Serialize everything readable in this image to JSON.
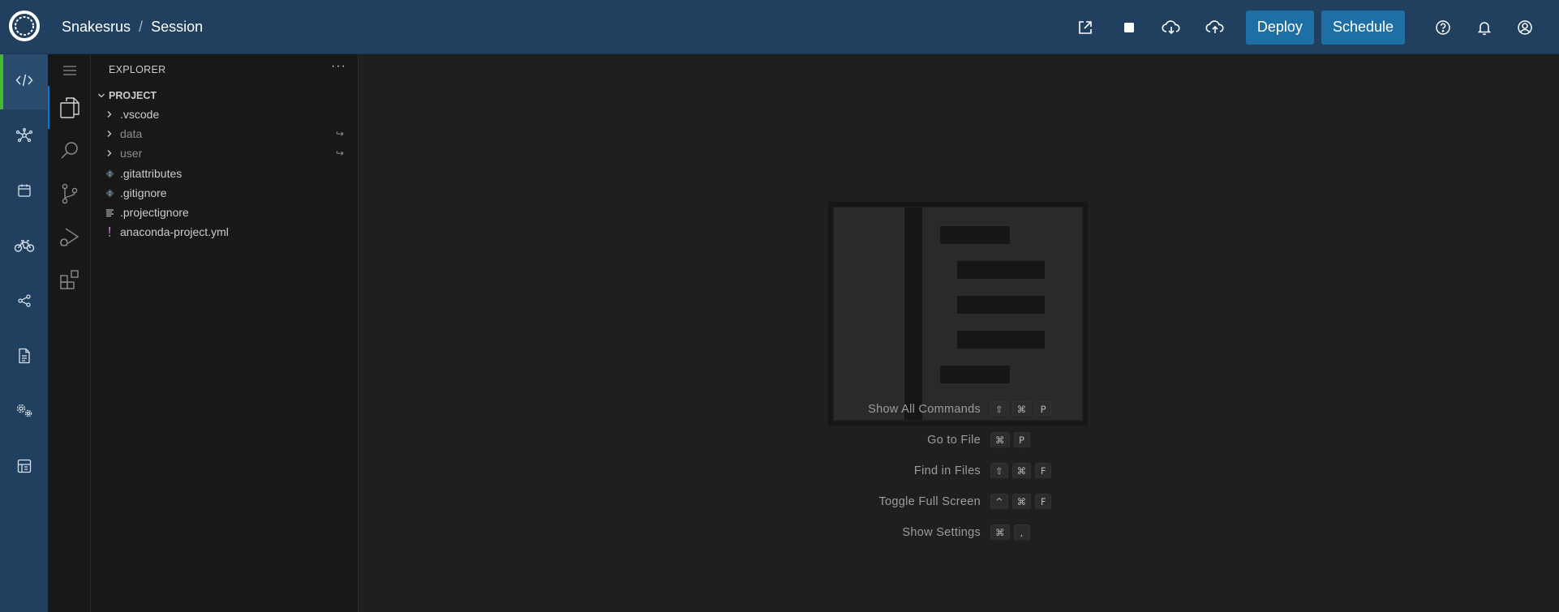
{
  "topbar": {
    "project": "Snakesrus",
    "separator": "/",
    "page": "Session",
    "deploy_label": "Deploy",
    "schedule_label": "Schedule",
    "accent_color": "#1e6fa6",
    "background_color": "#21405f"
  },
  "appnav": {
    "items": [
      {
        "name": "code",
        "icon": "code-icon",
        "active": true
      },
      {
        "name": "network",
        "icon": "network-icon"
      },
      {
        "name": "calendar",
        "icon": "calendar-icon"
      },
      {
        "name": "bicycle",
        "icon": "bicycle-icon"
      },
      {
        "name": "share",
        "icon": "share-icon"
      },
      {
        "name": "document",
        "icon": "document-icon"
      },
      {
        "name": "settings",
        "icon": "gears-icon"
      },
      {
        "name": "storage",
        "icon": "storage-icon"
      }
    ]
  },
  "activity_bar": {
    "items": [
      "menu-icon",
      "files-icon",
      "search-icon",
      "source-control-icon",
      "run-debug-icon",
      "extensions-icon"
    ]
  },
  "explorer": {
    "title": "EXPLORER",
    "more": "···",
    "project_label": "PROJECT",
    "tree": [
      {
        "label": ".vscode",
        "type": "folder",
        "dim": false
      },
      {
        "label": "data",
        "type": "folder",
        "dim": true,
        "decoration": "↪"
      },
      {
        "label": "user",
        "type": "folder",
        "dim": true,
        "decoration": "↪"
      },
      {
        "label": ".gitattributes",
        "type": "git"
      },
      {
        "label": ".gitignore",
        "type": "git"
      },
      {
        "label": ".projectignore",
        "type": "text"
      },
      {
        "label": "anaconda-project.yml",
        "type": "yaml"
      }
    ]
  },
  "editor": {
    "shortcuts": [
      {
        "label": "Show All Commands",
        "keys": [
          "⇧",
          "⌘",
          "P"
        ]
      },
      {
        "label": "Go to File",
        "keys": [
          "⌘",
          "P"
        ]
      },
      {
        "label": "Find in Files",
        "keys": [
          "⇧",
          "⌘",
          "F"
        ]
      },
      {
        "label": "Toggle Full Screen",
        "keys": [
          "^",
          "⌘",
          "F"
        ]
      },
      {
        "label": "Show Settings",
        "keys": [
          "⌘",
          ","
        ]
      }
    ]
  }
}
